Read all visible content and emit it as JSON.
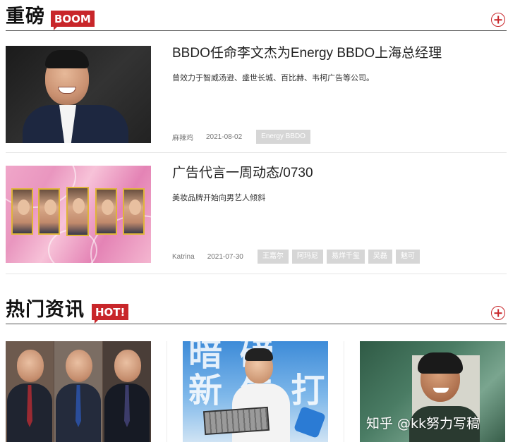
{
  "sections": {
    "featured": {
      "title": "重磅",
      "badge": "BOOM"
    },
    "hot": {
      "title": "热门资讯",
      "badge": "HOT!"
    }
  },
  "articles": [
    {
      "headline": "BBDO任命李文杰为Energy BBDO上海总经理",
      "summary": "曾效力于智威汤逊、盛世长城、百比赫、韦柯广告等公司。",
      "author": "麻辣鸡",
      "date": "2021-08-02",
      "tags": [
        "Energy BBDO"
      ]
    },
    {
      "headline": "广告代言一周动态/0730",
      "summary": "美妆品牌开始向男艺人倾斜",
      "author": "Katrina",
      "date": "2021-07-30",
      "tags": [
        "王嘉尔",
        "阿玛尼",
        "易烊千玺",
        "吴磊",
        "魅可"
      ]
    }
  ],
  "grid_cards": [
    {
      "kind": "three-executives-photo"
    },
    {
      "kind": "man-with-suitcase-photo",
      "background_text": "暗 磅\n新 生 打 工"
    },
    {
      "kind": "smiling-man-portrait-photo"
    }
  ],
  "watermark": "知乎 @kk努力写稿",
  "colors": {
    "accent_red": "#c8262a",
    "tag_gray": "#d6d6d6",
    "rule": "#555555"
  },
  "icons": {
    "section_more": "plus-circle-icon"
  }
}
